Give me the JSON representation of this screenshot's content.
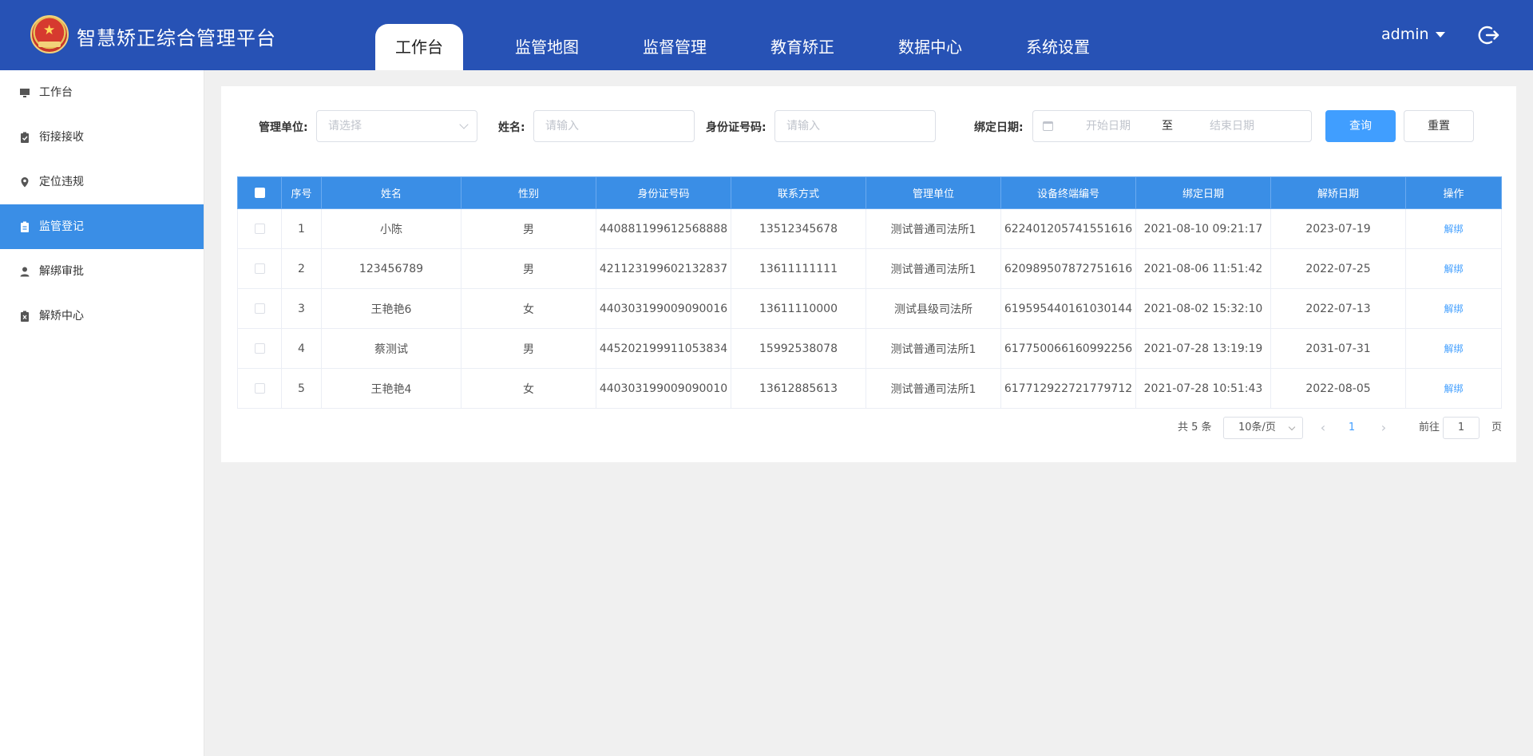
{
  "app": {
    "title": "智慧矫正综合管理平台",
    "logo_icon": "emblem-icon"
  },
  "nav": [
    {
      "label": "工作台",
      "active": true
    },
    {
      "label": "监管地图"
    },
    {
      "label": "监督管理"
    },
    {
      "label": "教育矫正"
    },
    {
      "label": "数据中心"
    },
    {
      "label": "系统设置"
    }
  ],
  "user": {
    "name": "admin",
    "logout_icon": "logout-icon"
  },
  "sidebar": {
    "items": [
      {
        "label": "工作台",
        "icon": "monitor-icon"
      },
      {
        "label": "衔接接收",
        "icon": "clipboard-check-icon"
      },
      {
        "label": "定位违规",
        "icon": "location-pin-icon"
      },
      {
        "label": "监管登记",
        "icon": "clipboard-icon",
        "active": true
      },
      {
        "label": "解绑审批",
        "icon": "user-icon"
      },
      {
        "label": "解矫中心",
        "icon": "clipboard-x-icon"
      }
    ]
  },
  "filters": {
    "unit_label": "管理单位:",
    "unit_placeholder": "请选择",
    "name_label": "姓名:",
    "name_placeholder": "请输入",
    "id_label": "身份证号码:",
    "id_placeholder": "请输入",
    "date_label": "绑定日期:",
    "date_start": "开始日期",
    "date_to": "至",
    "date_end": "结束日期",
    "query_button": "查询",
    "reset_button": "重置"
  },
  "table": {
    "columns": [
      "序号",
      "姓名",
      "性别",
      "身份证号码",
      "联系方式",
      "管理单位",
      "设备终端编号",
      "绑定日期",
      "解矫日期",
      "操作"
    ],
    "rows": [
      [
        "1",
        "小陈",
        "男",
        "440881199612568888",
        "13512345678",
        "测试普通司法所1",
        "622401205741551616",
        "2021-08-10 09:21:17",
        "2023-07-19",
        "解绑"
      ],
      [
        "2",
        "123456789",
        "男",
        "421123199602132837",
        "13611111111",
        "测试普通司法所1",
        "620989507872751616",
        "2021-08-06 11:51:42",
        "2022-07-25",
        "解绑"
      ],
      [
        "3",
        "王艳艳6",
        "女",
        "440303199009090016",
        "13611110000",
        "测试县级司法所",
        "619595440161030144",
        "2021-08-02 15:32:10",
        "2022-07-13",
        "解绑"
      ],
      [
        "4",
        "蔡测试",
        "男",
        "445202199911053834",
        "15992538078",
        "测试普通司法所1",
        "617750066160992256",
        "2021-07-28 13:19:19",
        "2031-07-31",
        "解绑"
      ],
      [
        "5",
        "王艳艳4",
        "女",
        "440303199009090010",
        "13612885613",
        "测试普通司法所1",
        "617712922721779712",
        "2021-07-28 10:51:43",
        "2022-08-05",
        "解绑"
      ]
    ]
  },
  "pagination": {
    "total": "共 5 条",
    "page_size": "10条/页",
    "current_page": "1",
    "goto_label": "前往",
    "goto_value": "1",
    "page_suffix": "页"
  },
  "colors": {
    "header": "#2752b5",
    "accent": "#409eff",
    "active_side": "#3a8ee6"
  }
}
